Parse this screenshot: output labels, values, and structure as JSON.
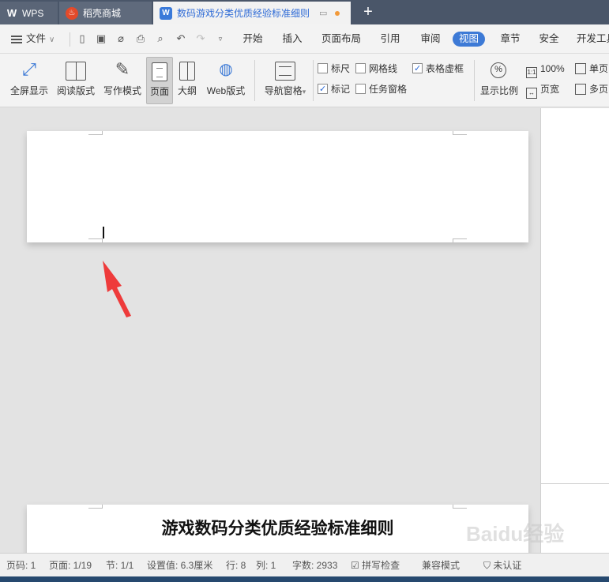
{
  "tabs": {
    "wps": "WPS",
    "store": "稻壳商城",
    "document": "数码游戏分类优质经验标准细则"
  },
  "menu": {
    "file": "文件",
    "tabs": [
      "开始",
      "插入",
      "页面布局",
      "引用",
      "审阅",
      "视图",
      "章节",
      "安全",
      "开发工具"
    ],
    "active_tab": "视图"
  },
  "ribbon": {
    "fullscreen": "全屏显示",
    "reading": "阅读版式",
    "writing": "写作模式",
    "page": "页面",
    "outline": "大纲",
    "web": "Web版式",
    "nav_pane": "导航窗格",
    "checks": {
      "ruler": "标尺",
      "gridlines": "网格线",
      "table_gridlines": "表格虚框",
      "marks": "标记",
      "task_pane": "任务窗格"
    },
    "zoom_label": "显示比例",
    "zoom_value": "100%",
    "zoom_box": "1:1",
    "page_width": "页宽",
    "single_page": "单页",
    "multi_page": "多页"
  },
  "document": {
    "heading": "游戏数码分类优质经验标准细则"
  },
  "status": {
    "page_no": "页码: 1",
    "pages": "页面: 1/19",
    "section": "节: 1/1",
    "setting": "设置值: 6.3厘米",
    "row": "行: 8",
    "col": "列: 1",
    "word_count": "字数: 2933",
    "spell_check": "拼写检查",
    "compat_mode": "兼容模式",
    "cert": "未认证"
  },
  "watermark": "Baidu经验",
  "colors": {
    "accent": "#3d7ad6",
    "tabbar": "#4a5669",
    "arrow": "#ee3b3b"
  }
}
